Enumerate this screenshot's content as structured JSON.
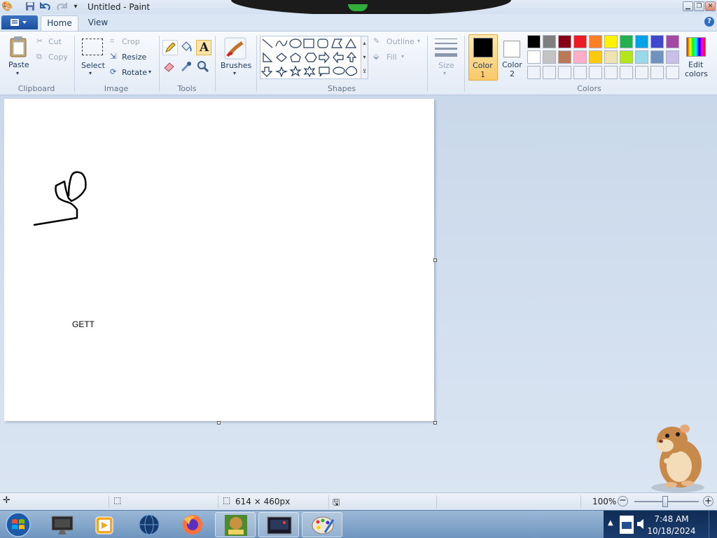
{
  "window": {
    "title": "Untitled - Paint",
    "controls": [
      "minimize",
      "maximize",
      "close"
    ]
  },
  "tabs": {
    "home": "Home",
    "view": "View"
  },
  "ribbon": {
    "clipboard": {
      "group": "Clipboard",
      "paste": "Paste",
      "cut": "Cut",
      "copy": "Copy"
    },
    "image": {
      "group": "Image",
      "select": "Select",
      "crop": "Crop",
      "resize": "Resize",
      "rotate": "Rotate"
    },
    "tools": {
      "group": "Tools"
    },
    "brushes": {
      "label": "Brushes"
    },
    "shapes": {
      "group": "Shapes",
      "outline": "Outline",
      "fill": "Fill"
    },
    "size": {
      "label": "Size"
    },
    "colors": {
      "group": "Colors",
      "color1_line1": "Color",
      "color1_line2": "1",
      "color2_line1": "Color",
      "color2_line2": "2",
      "edit_line1": "Edit",
      "edit_line2": "colors",
      "color1_value": "#000000",
      "color2_value": "#ffffff",
      "palette_row1": [
        "#000000",
        "#7f7f7f",
        "#880015",
        "#ed1c24",
        "#ff7f27",
        "#fff200",
        "#22b14c",
        "#00a2e8",
        "#3f48cc",
        "#a349a4"
      ],
      "palette_row2": [
        "#ffffff",
        "#c3c3c3",
        "#b97a57",
        "#ffaec9",
        "#ffc90e",
        "#efe4b0",
        "#b5e61d",
        "#99d9ea",
        "#7092be",
        "#c8bfe7"
      ]
    }
  },
  "canvas": {
    "text": "GETT"
  },
  "status": {
    "dimensions": "614 × 460px",
    "zoom": "100%"
  },
  "taskbar": {
    "apps": [
      "start-orb",
      "task-manager",
      "media-player",
      "network-globe",
      "firefox",
      "game-box",
      "display-app",
      "paint"
    ],
    "active_app": "paint",
    "time": "7:48 AM",
    "date": "10/18/2024"
  }
}
